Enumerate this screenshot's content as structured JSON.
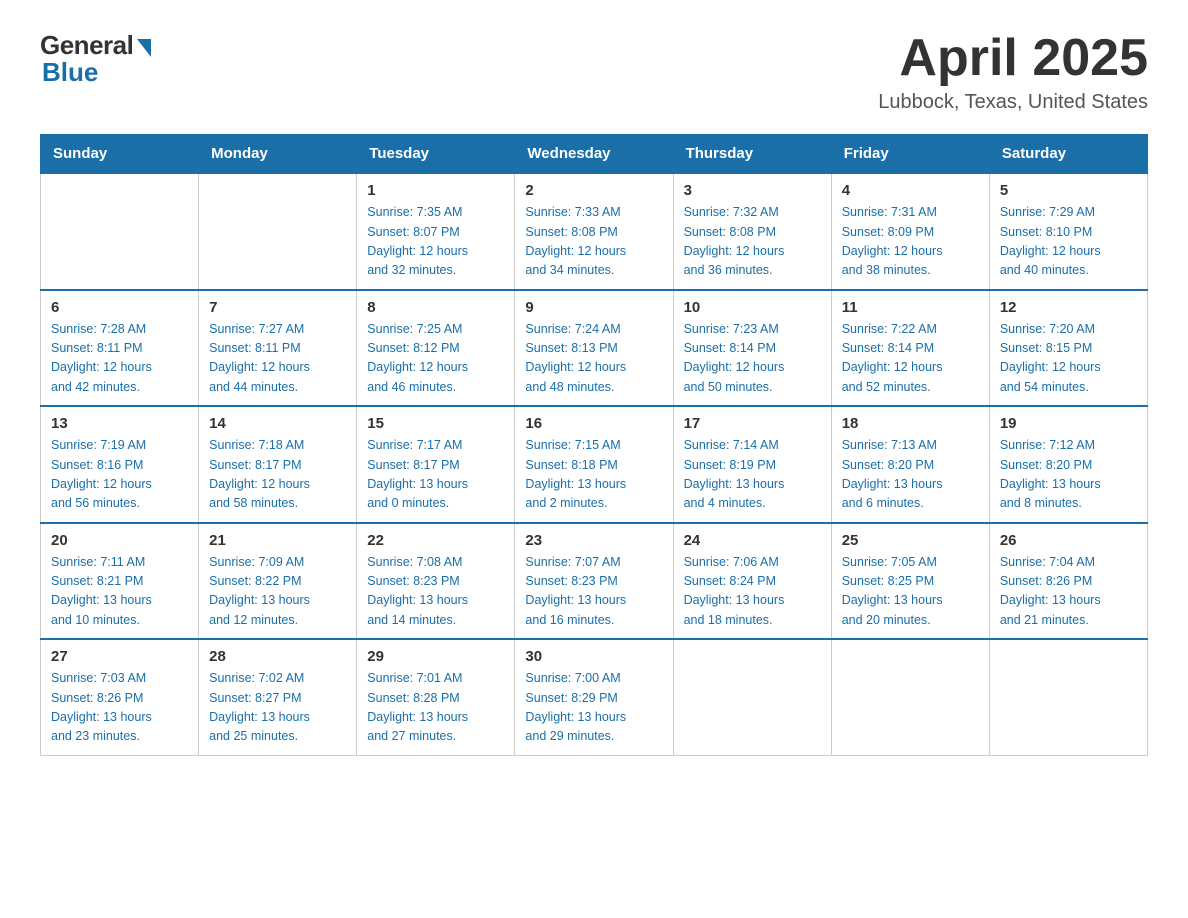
{
  "logo": {
    "general": "General",
    "blue": "Blue"
  },
  "title": "April 2025",
  "location": "Lubbock, Texas, United States",
  "days_of_week": [
    "Sunday",
    "Monday",
    "Tuesday",
    "Wednesday",
    "Thursday",
    "Friday",
    "Saturday"
  ],
  "weeks": [
    [
      {
        "day": "",
        "info": ""
      },
      {
        "day": "",
        "info": ""
      },
      {
        "day": "1",
        "info": "Sunrise: 7:35 AM\nSunset: 8:07 PM\nDaylight: 12 hours\nand 32 minutes."
      },
      {
        "day": "2",
        "info": "Sunrise: 7:33 AM\nSunset: 8:08 PM\nDaylight: 12 hours\nand 34 minutes."
      },
      {
        "day": "3",
        "info": "Sunrise: 7:32 AM\nSunset: 8:08 PM\nDaylight: 12 hours\nand 36 minutes."
      },
      {
        "day": "4",
        "info": "Sunrise: 7:31 AM\nSunset: 8:09 PM\nDaylight: 12 hours\nand 38 minutes."
      },
      {
        "day": "5",
        "info": "Sunrise: 7:29 AM\nSunset: 8:10 PM\nDaylight: 12 hours\nand 40 minutes."
      }
    ],
    [
      {
        "day": "6",
        "info": "Sunrise: 7:28 AM\nSunset: 8:11 PM\nDaylight: 12 hours\nand 42 minutes."
      },
      {
        "day": "7",
        "info": "Sunrise: 7:27 AM\nSunset: 8:11 PM\nDaylight: 12 hours\nand 44 minutes."
      },
      {
        "day": "8",
        "info": "Sunrise: 7:25 AM\nSunset: 8:12 PM\nDaylight: 12 hours\nand 46 minutes."
      },
      {
        "day": "9",
        "info": "Sunrise: 7:24 AM\nSunset: 8:13 PM\nDaylight: 12 hours\nand 48 minutes."
      },
      {
        "day": "10",
        "info": "Sunrise: 7:23 AM\nSunset: 8:14 PM\nDaylight: 12 hours\nand 50 minutes."
      },
      {
        "day": "11",
        "info": "Sunrise: 7:22 AM\nSunset: 8:14 PM\nDaylight: 12 hours\nand 52 minutes."
      },
      {
        "day": "12",
        "info": "Sunrise: 7:20 AM\nSunset: 8:15 PM\nDaylight: 12 hours\nand 54 minutes."
      }
    ],
    [
      {
        "day": "13",
        "info": "Sunrise: 7:19 AM\nSunset: 8:16 PM\nDaylight: 12 hours\nand 56 minutes."
      },
      {
        "day": "14",
        "info": "Sunrise: 7:18 AM\nSunset: 8:17 PM\nDaylight: 12 hours\nand 58 minutes."
      },
      {
        "day": "15",
        "info": "Sunrise: 7:17 AM\nSunset: 8:17 PM\nDaylight: 13 hours\nand 0 minutes."
      },
      {
        "day": "16",
        "info": "Sunrise: 7:15 AM\nSunset: 8:18 PM\nDaylight: 13 hours\nand 2 minutes."
      },
      {
        "day": "17",
        "info": "Sunrise: 7:14 AM\nSunset: 8:19 PM\nDaylight: 13 hours\nand 4 minutes."
      },
      {
        "day": "18",
        "info": "Sunrise: 7:13 AM\nSunset: 8:20 PM\nDaylight: 13 hours\nand 6 minutes."
      },
      {
        "day": "19",
        "info": "Sunrise: 7:12 AM\nSunset: 8:20 PM\nDaylight: 13 hours\nand 8 minutes."
      }
    ],
    [
      {
        "day": "20",
        "info": "Sunrise: 7:11 AM\nSunset: 8:21 PM\nDaylight: 13 hours\nand 10 minutes."
      },
      {
        "day": "21",
        "info": "Sunrise: 7:09 AM\nSunset: 8:22 PM\nDaylight: 13 hours\nand 12 minutes."
      },
      {
        "day": "22",
        "info": "Sunrise: 7:08 AM\nSunset: 8:23 PM\nDaylight: 13 hours\nand 14 minutes."
      },
      {
        "day": "23",
        "info": "Sunrise: 7:07 AM\nSunset: 8:23 PM\nDaylight: 13 hours\nand 16 minutes."
      },
      {
        "day": "24",
        "info": "Sunrise: 7:06 AM\nSunset: 8:24 PM\nDaylight: 13 hours\nand 18 minutes."
      },
      {
        "day": "25",
        "info": "Sunrise: 7:05 AM\nSunset: 8:25 PM\nDaylight: 13 hours\nand 20 minutes."
      },
      {
        "day": "26",
        "info": "Sunrise: 7:04 AM\nSunset: 8:26 PM\nDaylight: 13 hours\nand 21 minutes."
      }
    ],
    [
      {
        "day": "27",
        "info": "Sunrise: 7:03 AM\nSunset: 8:26 PM\nDaylight: 13 hours\nand 23 minutes."
      },
      {
        "day": "28",
        "info": "Sunrise: 7:02 AM\nSunset: 8:27 PM\nDaylight: 13 hours\nand 25 minutes."
      },
      {
        "day": "29",
        "info": "Sunrise: 7:01 AM\nSunset: 8:28 PM\nDaylight: 13 hours\nand 27 minutes."
      },
      {
        "day": "30",
        "info": "Sunrise: 7:00 AM\nSunset: 8:29 PM\nDaylight: 13 hours\nand 29 minutes."
      },
      {
        "day": "",
        "info": ""
      },
      {
        "day": "",
        "info": ""
      },
      {
        "day": "",
        "info": ""
      }
    ]
  ]
}
